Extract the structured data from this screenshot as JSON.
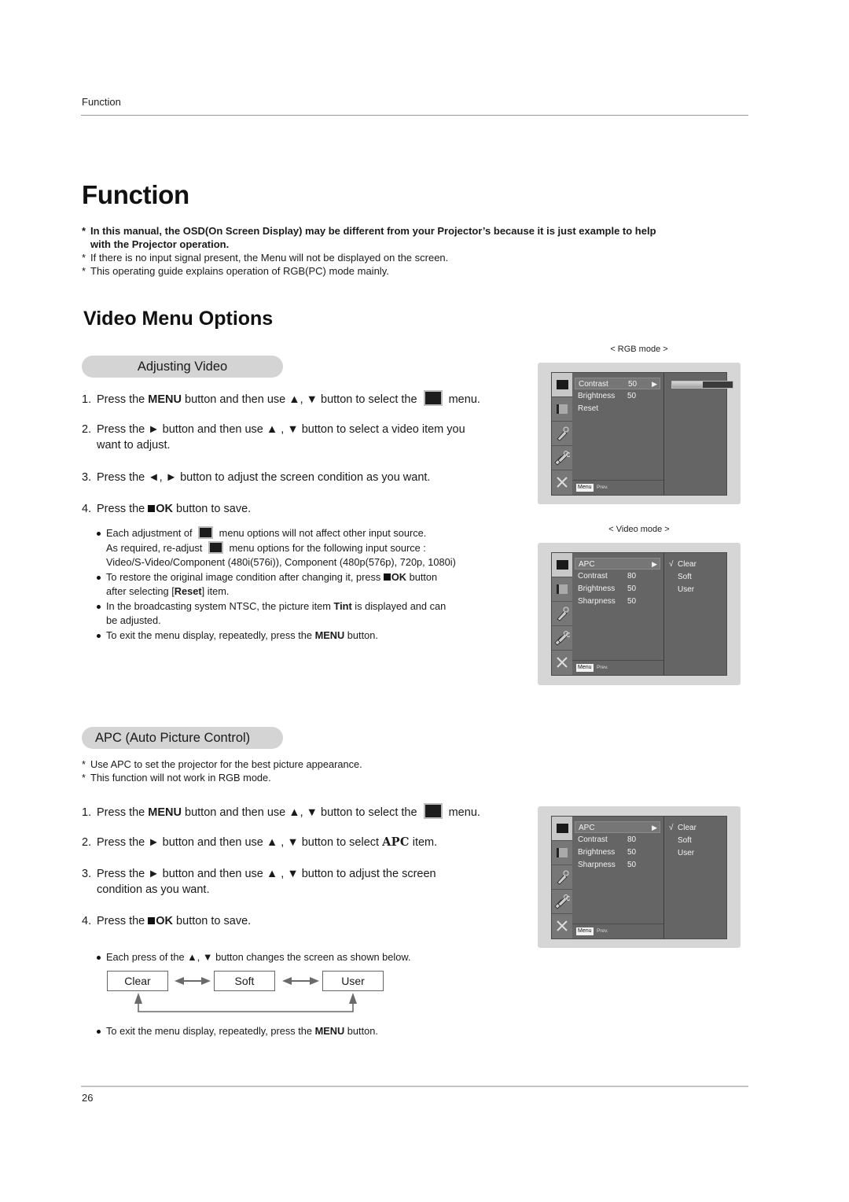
{
  "header": {
    "running_head": "Function",
    "page_title": "Function"
  },
  "notes": {
    "n1_line1": "In this manual, the OSD(On Screen Display) may be different from your Projector’s because it is just example to help",
    "n1_line2": "with the Projector operation.",
    "n2": "If there is no input signal present, the Menu will not be displayed on the screen.",
    "n3": "This operating guide explains operation of RGB(PC) mode mainly.",
    "asterisk": "*"
  },
  "section": {
    "title": "Video Menu Options"
  },
  "adjusting_video": {
    "heading": "Adjusting Video",
    "steps": [
      {
        "num": "1.",
        "a": "Press the ",
        "b": "MENU",
        "c": " button and then use ▲, ▼ button to select the ",
        "d": " menu."
      },
      {
        "num": "2.",
        "a": "Press the ► button and then use ▲ , ▼ button to select a video item you",
        "cont": "want to adjust."
      },
      {
        "num": "3.",
        "a": "Press the ◄, ► button to adjust the screen condition as you want."
      },
      {
        "num": "4.",
        "a": "Press the ",
        "ok": "OK",
        "c": " button to save."
      }
    ],
    "bullets": {
      "b1_a": "Each adjustment of ",
      "b1_b": " menu options will not affect other input source.",
      "b1_c": "As required, re-adjust ",
      "b1_d": " menu options for the following input source :",
      "b1_e": "Video/S-Video/Component (480i(576i)), Component (480p(576p), 720p, 1080i)",
      "b2_a": "To restore the original image condition after changing it, press ",
      "b2_ok": "OK",
      "b2_b": " button",
      "b2_c": "after selecting [",
      "b2_reset": "Reset",
      "b2_d": "] item.",
      "b3_a": "In the broadcasting system NTSC, the picture item ",
      "b3_tint": "Tint",
      "b3_b": " is displayed and can",
      "b3_c": "be adjusted.",
      "b4_a": "To exit the menu display, repeatedly, press the ",
      "b4_menu": "MENU",
      "b4_b": " button."
    }
  },
  "apc": {
    "heading": "APC (Auto Picture Control)",
    "notes": [
      "Use APC to set the projector for the best picture appearance.",
      "This function will not work in RGB mode."
    ],
    "steps": [
      {
        "num": "1.",
        "a": "Press the ",
        "b": "MENU",
        "c": " button and then use ▲, ▼ button to select the ",
        "d": " menu."
      },
      {
        "num": "2.",
        "a": "Press the ► button and then use ▲ , ▼ button to select ",
        "apc": "APC",
        "c": " item."
      },
      {
        "num": "3.",
        "a": "Press the ► button and then use ▲ , ▼ button to adjust the screen",
        "cont": "condition as you want."
      },
      {
        "num": "4.",
        "a": "Press the ",
        "ok": "OK",
        "c": " button to save."
      }
    ],
    "bullet_cycle": "Each press of the ▲, ▼ button changes the screen as shown below.",
    "cycle": [
      "Clear",
      "Soft",
      "User"
    ],
    "bullet_exit_a": "To exit the menu display, repeatedly, press the ",
    "bullet_exit_menu": "MENU",
    "bullet_exit_b": " button."
  },
  "osd_rgb": {
    "mode_label": "< RGB mode >",
    "items": [
      {
        "label": "Contrast",
        "value": "50",
        "arrow": "▶",
        "selected": true
      },
      {
        "label": "Brightness",
        "value": "50"
      },
      {
        "label": "Reset",
        "value": ""
      }
    ],
    "contrast_level_percent": 50,
    "footer_key": "Menu",
    "footer_prev": "Prev."
  },
  "osd_video": {
    "mode_label": "< Video mode >",
    "items": [
      {
        "label": "APC",
        "value": "",
        "arrow": "▶",
        "selected": true
      },
      {
        "label": "Contrast",
        "value": "80"
      },
      {
        "label": "Brightness",
        "value": "50"
      },
      {
        "label": "Sharpness",
        "value": "50"
      }
    ],
    "options": [
      {
        "check": "√",
        "label": "Clear"
      },
      {
        "check": "",
        "label": "Soft"
      },
      {
        "check": "",
        "label": "User"
      }
    ],
    "footer_key": "Menu",
    "footer_prev": "Prev."
  },
  "osd_apc": {
    "items": [
      {
        "label": "APC",
        "value": "",
        "arrow": "▶",
        "selected": true
      },
      {
        "label": "Contrast",
        "value": "80"
      },
      {
        "label": "Brightness",
        "value": "50"
      },
      {
        "label": "Sharpness",
        "value": "50"
      }
    ],
    "options": [
      {
        "check": "√",
        "label": "Clear"
      },
      {
        "check": "",
        "label": "Soft"
      },
      {
        "check": "",
        "label": "User"
      }
    ],
    "footer_key": "Menu",
    "footer_prev": "Prev."
  },
  "footer": {
    "page_number": "26"
  }
}
